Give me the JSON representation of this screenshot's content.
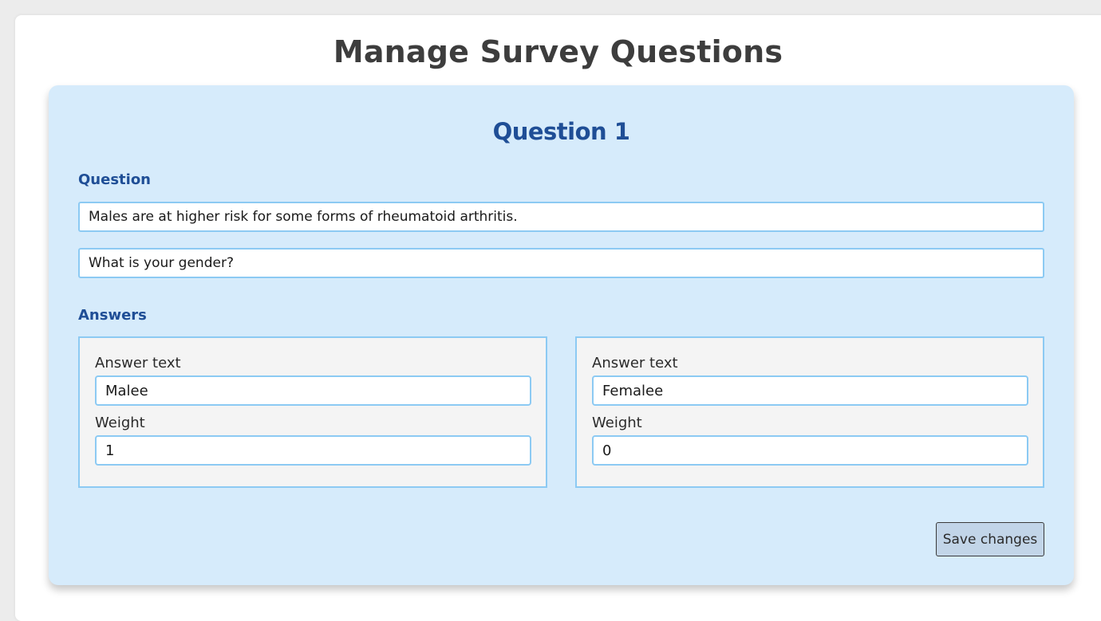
{
  "page": {
    "title": "Manage Survey Questions"
  },
  "question": {
    "heading": "Question 1",
    "section_label": "Question",
    "fact_text": "Males are at higher risk for some forms of rheumatoid arthritis.",
    "question_text": "What is your gender?"
  },
  "answers": {
    "section_label": "Answers",
    "items": [
      {
        "text_label": "Answer text",
        "text_value": "Malee",
        "weight_label": "Weight",
        "weight_value": "1"
      },
      {
        "text_label": "Answer text",
        "text_value": "Femalee",
        "weight_label": "Weight",
        "weight_value": "0"
      }
    ]
  },
  "actions": {
    "save_label": "Save changes"
  },
  "colors": {
    "background": "#ececec",
    "card": "#d6ebfb",
    "accent": "#1f4e96",
    "field_border": "#8ccaf3",
    "button": "#c2d5e8"
  }
}
